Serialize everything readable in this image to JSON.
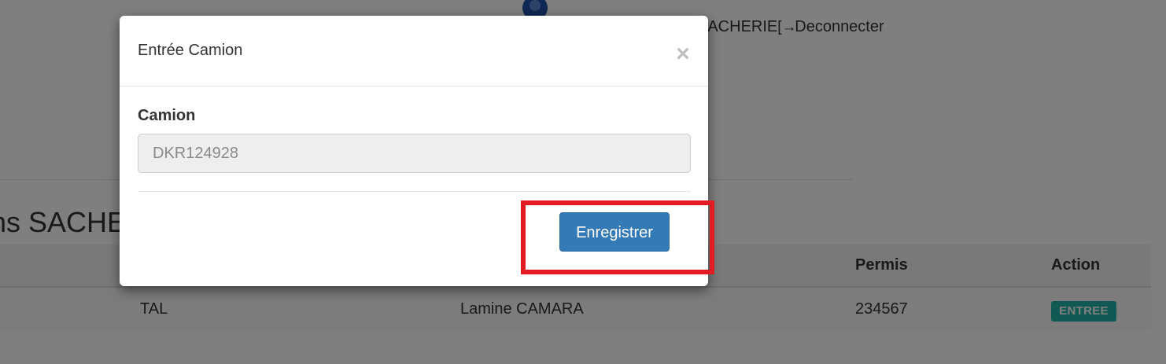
{
  "header": {
    "user_label": "SACHERIE",
    "logout_icon": "logout-icon",
    "logout_label": "Deconnecter"
  },
  "page": {
    "section_title": "ns SACHE"
  },
  "table": {
    "columns": [
      "Permis",
      "Action"
    ],
    "rows": [
      {
        "col_a": "TAL",
        "col_b": "Lamine CAMARA",
        "permis": "234567",
        "action": "ENTREE"
      }
    ]
  },
  "modal": {
    "title": "Entrée Camion",
    "close_label": "×",
    "field_label": "Camion",
    "field_value": "DKR124928",
    "save_label": "Enregistrer"
  },
  "colors": {
    "primary": "#337ab7",
    "badge": "#22b3a6",
    "highlight": "#e31b23"
  }
}
